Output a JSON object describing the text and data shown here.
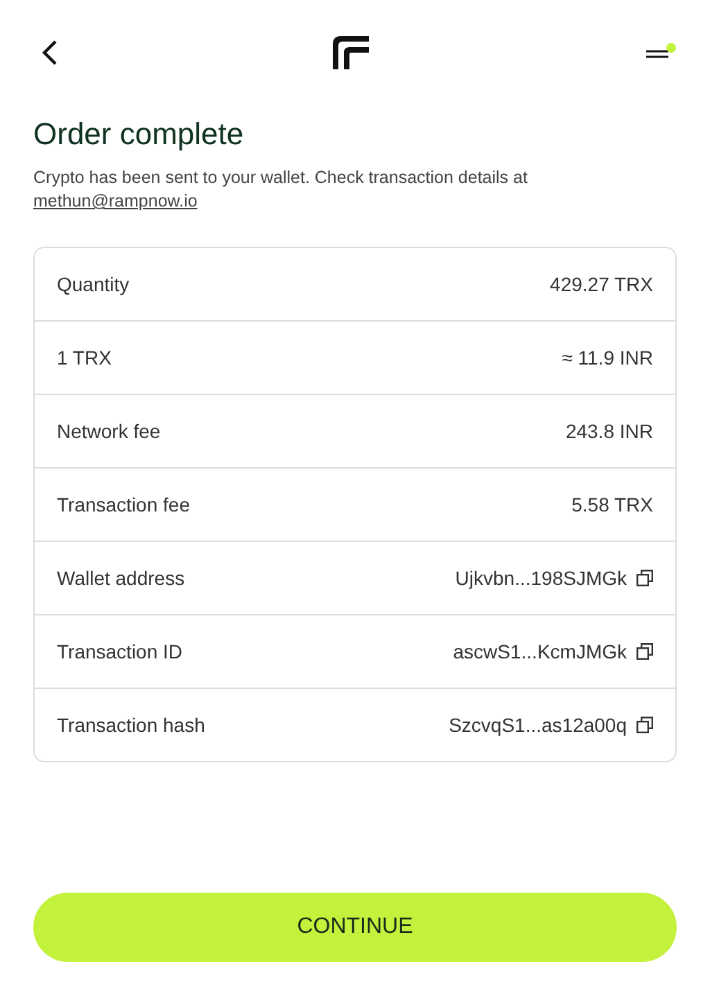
{
  "header": {
    "menu_notification": true
  },
  "title": "Order complete",
  "message": "Crypto has been sent to your wallet. Check transaction details at",
  "email": "methun@rampnow.io",
  "details": [
    {
      "label": "Quantity",
      "value": "429.27 TRX",
      "kind": "plain"
    },
    {
      "label": "1 TRX",
      "value": "≈ 11.9 INR",
      "kind": "plain"
    },
    {
      "label": "Network fee",
      "value": "243.8 INR",
      "kind": "plain"
    },
    {
      "label": "Transaction fee",
      "value": "5.58 TRX",
      "kind": "plain"
    },
    {
      "label": "Wallet address",
      "value": "Ujkvbn...198SJMGk",
      "kind": "copy"
    },
    {
      "label": "Transaction ID",
      "value": "ascwS1...KcmJMGk",
      "kind": "copy"
    },
    {
      "label": "Transaction hash",
      "value": "SzcvqS1...as12a00q",
      "kind": "copy"
    }
  ],
  "button": "CONTINUE"
}
